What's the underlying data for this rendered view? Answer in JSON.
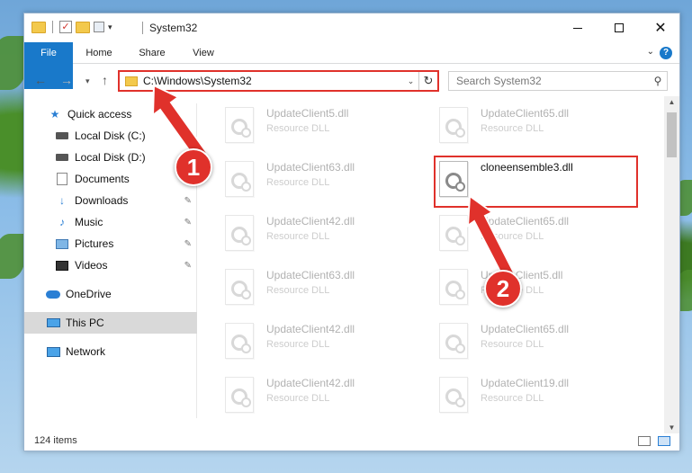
{
  "window": {
    "title": "System32",
    "minimize_glyph": "",
    "maximize_glyph": "",
    "close_glyph": "✕"
  },
  "ribbon": {
    "tabs": [
      "File",
      "Home",
      "Share",
      "View"
    ],
    "help": "?"
  },
  "address": {
    "path": "C:\\Windows\\System32",
    "search_placeholder": "Search System32"
  },
  "sidebar": {
    "items": [
      {
        "label": "Quick access",
        "icon": "star-icon",
        "pinned": false
      },
      {
        "label": "Local Disk (C:)",
        "icon": "disk-icon",
        "pinned": true
      },
      {
        "label": "Local Disk (D:)",
        "icon": "disk-icon",
        "pinned": false
      },
      {
        "label": "Documents",
        "icon": "documents-icon",
        "pinned": true
      },
      {
        "label": "Downloads",
        "icon": "download-icon",
        "pinned": true
      },
      {
        "label": "Music",
        "icon": "music-icon",
        "pinned": true
      },
      {
        "label": "Pictures",
        "icon": "pictures-icon",
        "pinned": true
      },
      {
        "label": "Videos",
        "icon": "videos-icon",
        "pinned": true
      },
      {
        "label": "OneDrive",
        "icon": "cloud-icon",
        "pinned": false
      },
      {
        "label": "This PC",
        "icon": "pc-icon",
        "pinned": false,
        "selected": true
      },
      {
        "label": "Network",
        "icon": "network-icon",
        "pinned": false
      }
    ]
  },
  "files": {
    "left_column": [
      {
        "name": "UpdateClient5.dll",
        "type": "Resource DLL"
      },
      {
        "name": "UpdateClient63.dll",
        "type": "Resource DLL"
      },
      {
        "name": "UpdateClient42.dll",
        "type": "Resource DLL"
      },
      {
        "name": "UpdateClient63.dll",
        "type": "Resource DLL"
      },
      {
        "name": "UpdateClient42.dll",
        "type": "Resource DLL"
      },
      {
        "name": "UpdateClient42.dll",
        "type": "Resource DLL"
      }
    ],
    "right_column": [
      {
        "name": "UpdateClient65.dll",
        "type": "Resource DLL"
      },
      {
        "name": "cloneensemble3.dll",
        "type": "",
        "highlighted": true
      },
      {
        "name": "UpdateClient65.dll",
        "type": "Resource DLL"
      },
      {
        "name": "UpdateClient5.dll",
        "type": "Resource DLL"
      },
      {
        "name": "UpdateClient65.dll",
        "type": "Resource DLL"
      },
      {
        "name": "UpdateClient19.dll",
        "type": "Resource DLL"
      }
    ]
  },
  "status": {
    "item_count": "124 items"
  },
  "callouts": {
    "one": "1",
    "two": "2",
    "color": "#e0312b"
  }
}
